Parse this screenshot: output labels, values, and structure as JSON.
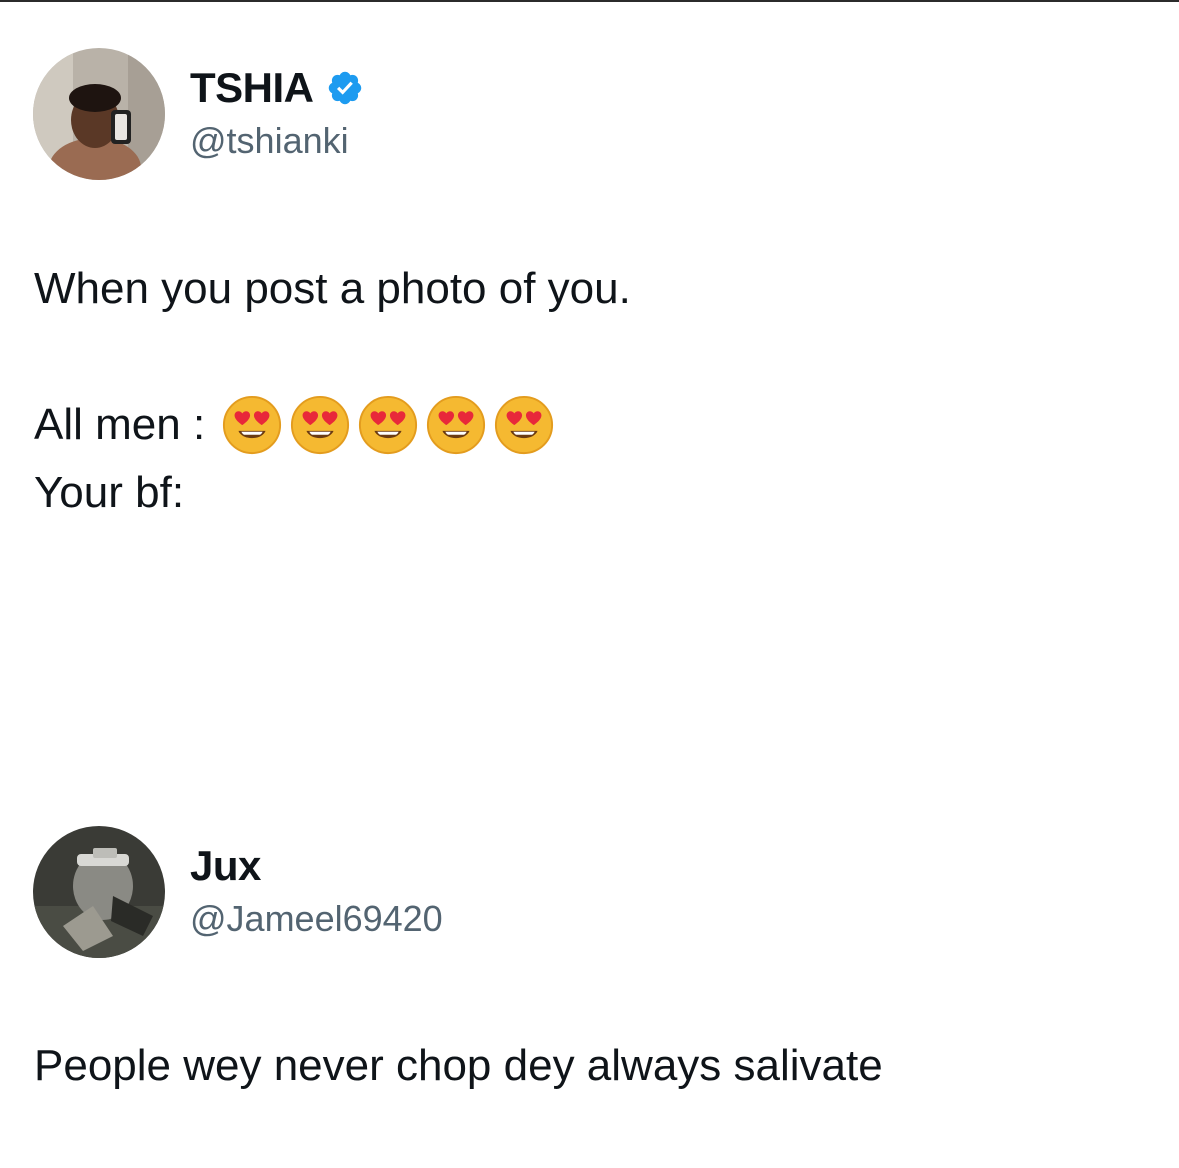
{
  "tweets": [
    {
      "display_name": "TSHIA",
      "verified": true,
      "handle": "@tshianki",
      "lines": [
        "When you post a photo of you.",
        "All men :",
        "Your bf:"
      ],
      "emojis": [
        "smiling-face-with-heart-eyes",
        "smiling-face-with-heart-eyes",
        "smiling-face-with-heart-eyes",
        "smiling-face-with-heart-eyes",
        "smiling-face-with-heart-eyes"
      ]
    },
    {
      "display_name": "Jux",
      "verified": false,
      "handle": "@Jameel69420",
      "lines": [
        "People wey never chop dey always salivate"
      ]
    }
  ],
  "colors": {
    "text": "#0f1419",
    "handle": "#536471",
    "verified": "#1d9bf0",
    "background": "#ffffff"
  }
}
